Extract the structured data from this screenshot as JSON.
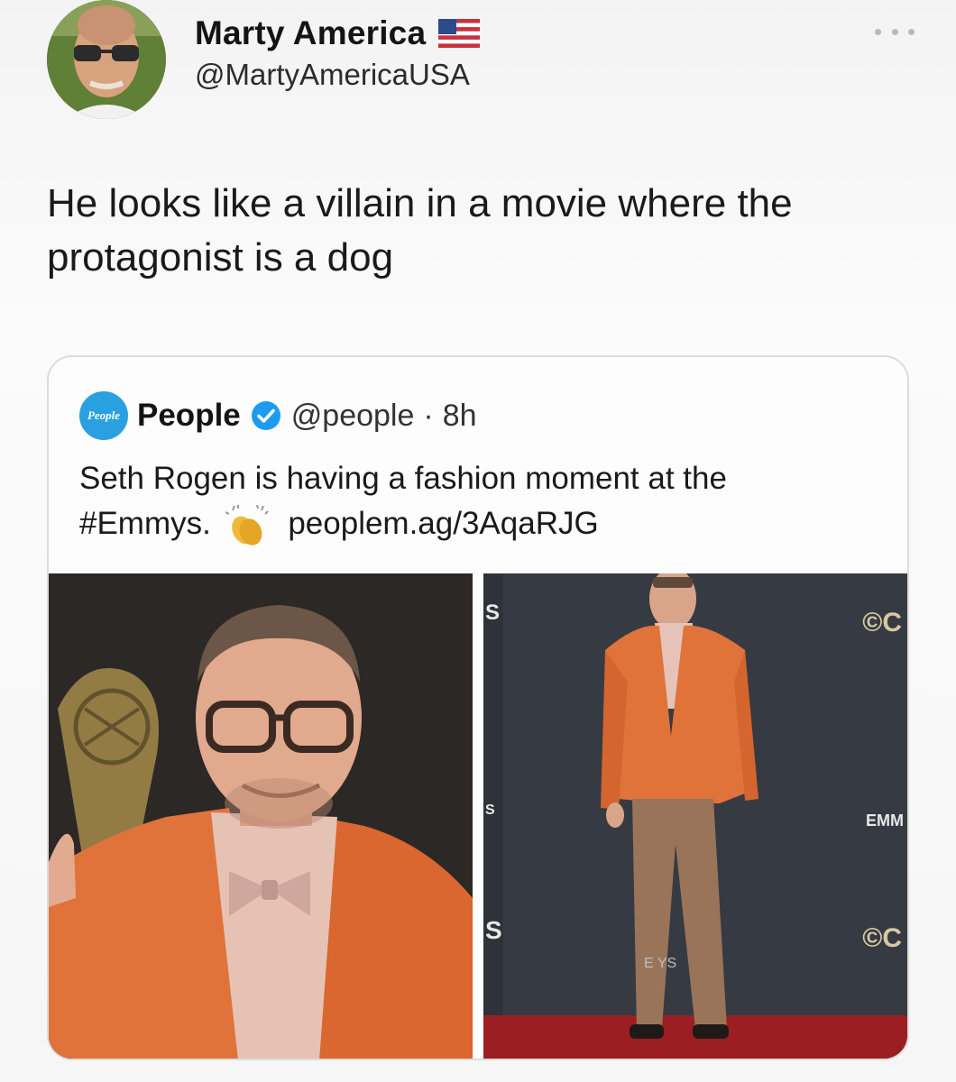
{
  "author": {
    "name": "Marty America",
    "handle": "@MartyAmericaUSA",
    "flag_icon": "us-flag-icon"
  },
  "tweet": {
    "text": "He looks like a villain in a movie where the protagonist is a dog"
  },
  "quoted": {
    "logo_text": "People",
    "name": "People",
    "handle": "@people",
    "separator": "·",
    "time": "8h",
    "text_line1": "Seth Rogen is having a fashion moment at the",
    "hashtag": "#Emmys.",
    "link": "peoplem.ag/3AqaRJG",
    "images": [
      {
        "subject": "close-up portrait in orange jacket and pink bow tie"
      },
      {
        "subject": "full-length photo in orange jacket and brown trousers on red carpet"
      }
    ],
    "watermarks": {
      "right_top": "©C",
      "right_mid": "EMM",
      "right_bottom": "©C",
      "left_strip_top": "S",
      "left_strip_mid": "S",
      "left_strip_bottom": "S",
      "floor": "E  YS"
    }
  },
  "colors": {
    "accent_blue": "#1d9bf0",
    "jacket_orange": "#e0733a"
  }
}
